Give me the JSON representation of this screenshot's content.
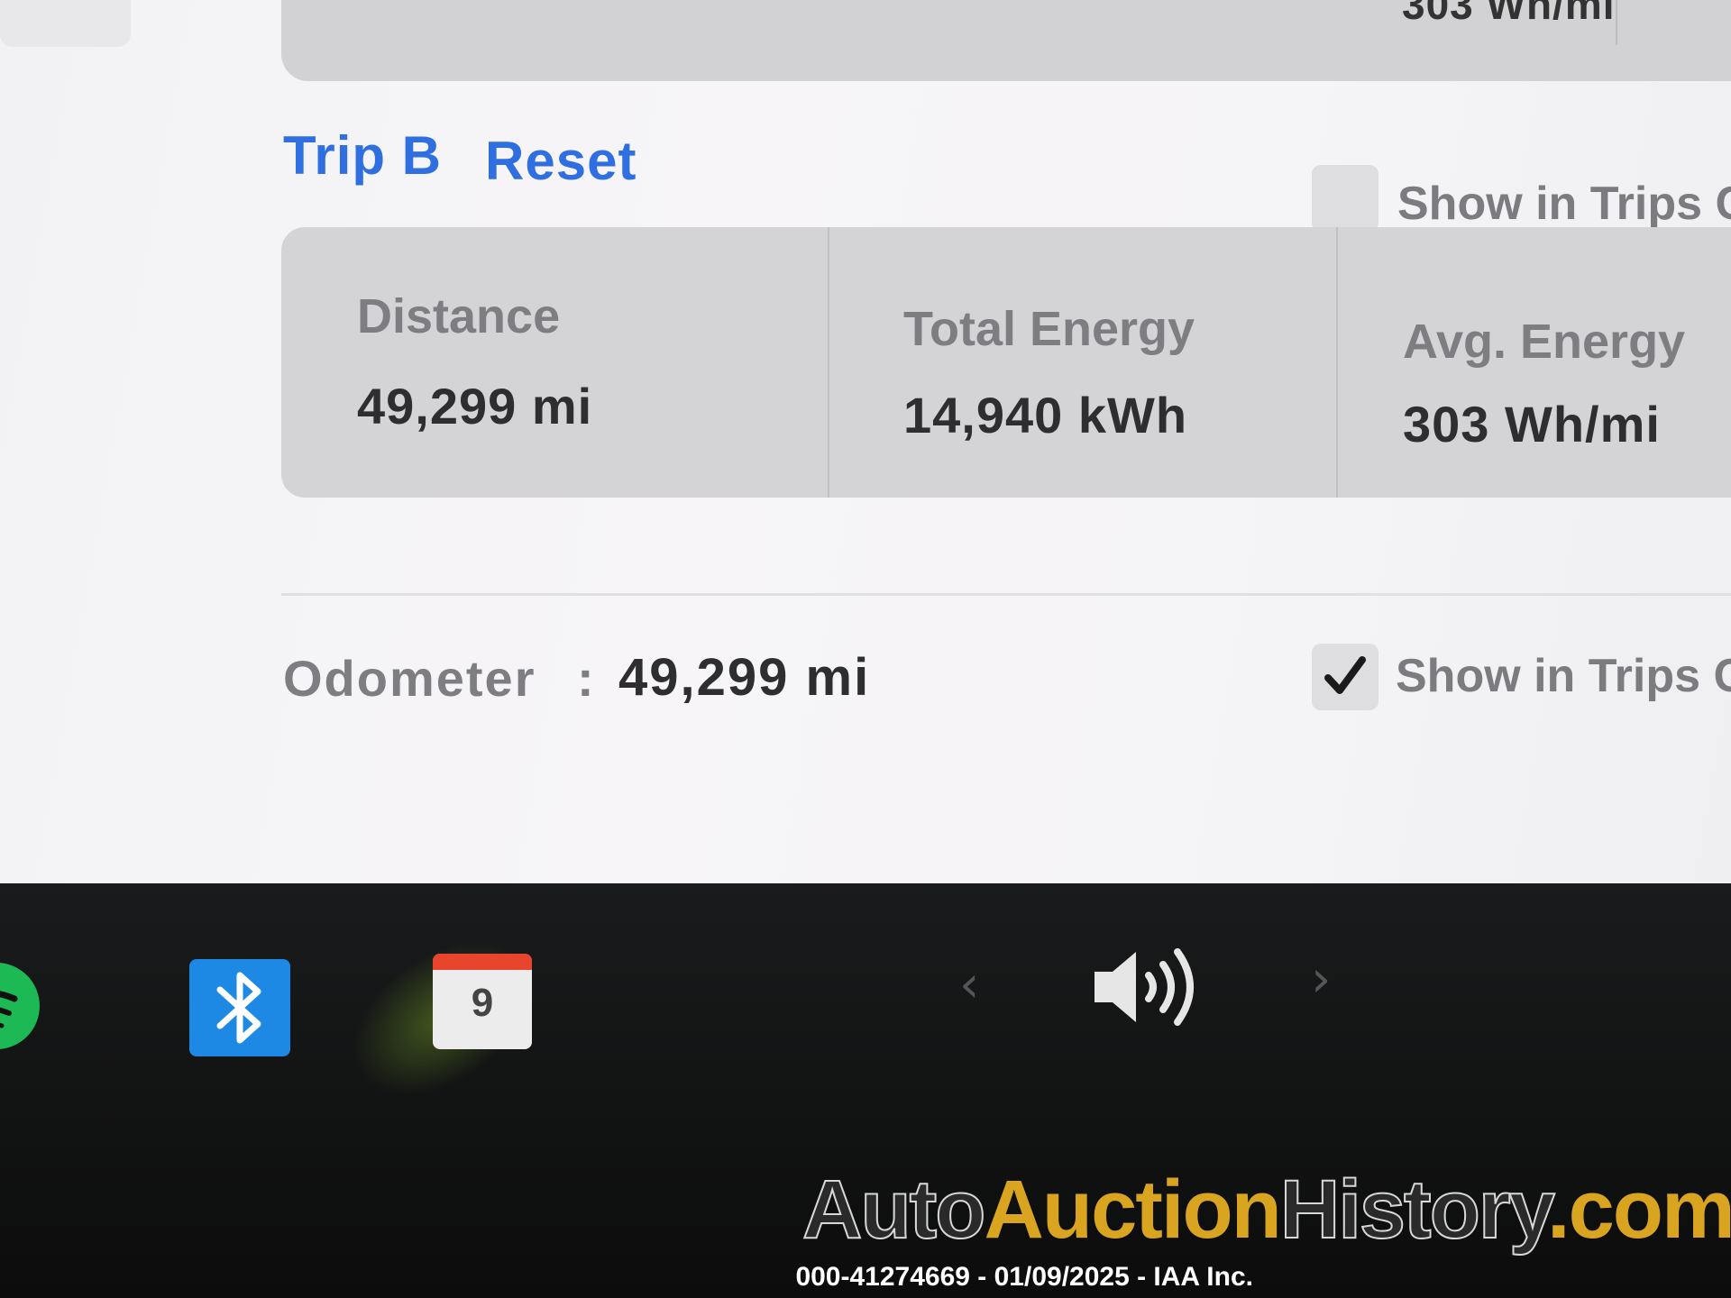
{
  "previous_card": {
    "avg_value": "303 Wh/mi"
  },
  "trip": {
    "title": "Trip B",
    "reset_label": "Reset",
    "show_in_trips_label": "Show in Trips Ca",
    "show_in_trips_checked": false,
    "stats": [
      {
        "label": "Distance",
        "value": "49,299  mi"
      },
      {
        "label": "Total Energy",
        "value": "14,940  kWh"
      },
      {
        "label": "Avg. Energy",
        "value": "303  Wh/mi"
      }
    ]
  },
  "odometer": {
    "label": "Odometer",
    "separator": ":",
    "value": "49,299  mi",
    "show_in_trips_label": "Show in Trips Ca",
    "show_in_trips_checked": true
  },
  "taskbar": {
    "calendar_day": "9",
    "icons": [
      "spotify-icon",
      "bluetooth-icon",
      "calendar-icon",
      "chevron-left-icon",
      "volume-icon",
      "chevron-right-icon"
    ],
    "accent_bluetooth": "#1e88e5",
    "accent_spotify": "#1db954"
  },
  "watermark": {
    "part1": "Auto",
    "part2": "Auction",
    "part3": "History",
    "part4": ".com",
    "caption": "000-41274669 - 01/09/2025 - IAA Inc."
  },
  "colors": {
    "link": "#2f6fe0",
    "card": "#d4d4d6",
    "muted_text": "#7d7d82"
  }
}
